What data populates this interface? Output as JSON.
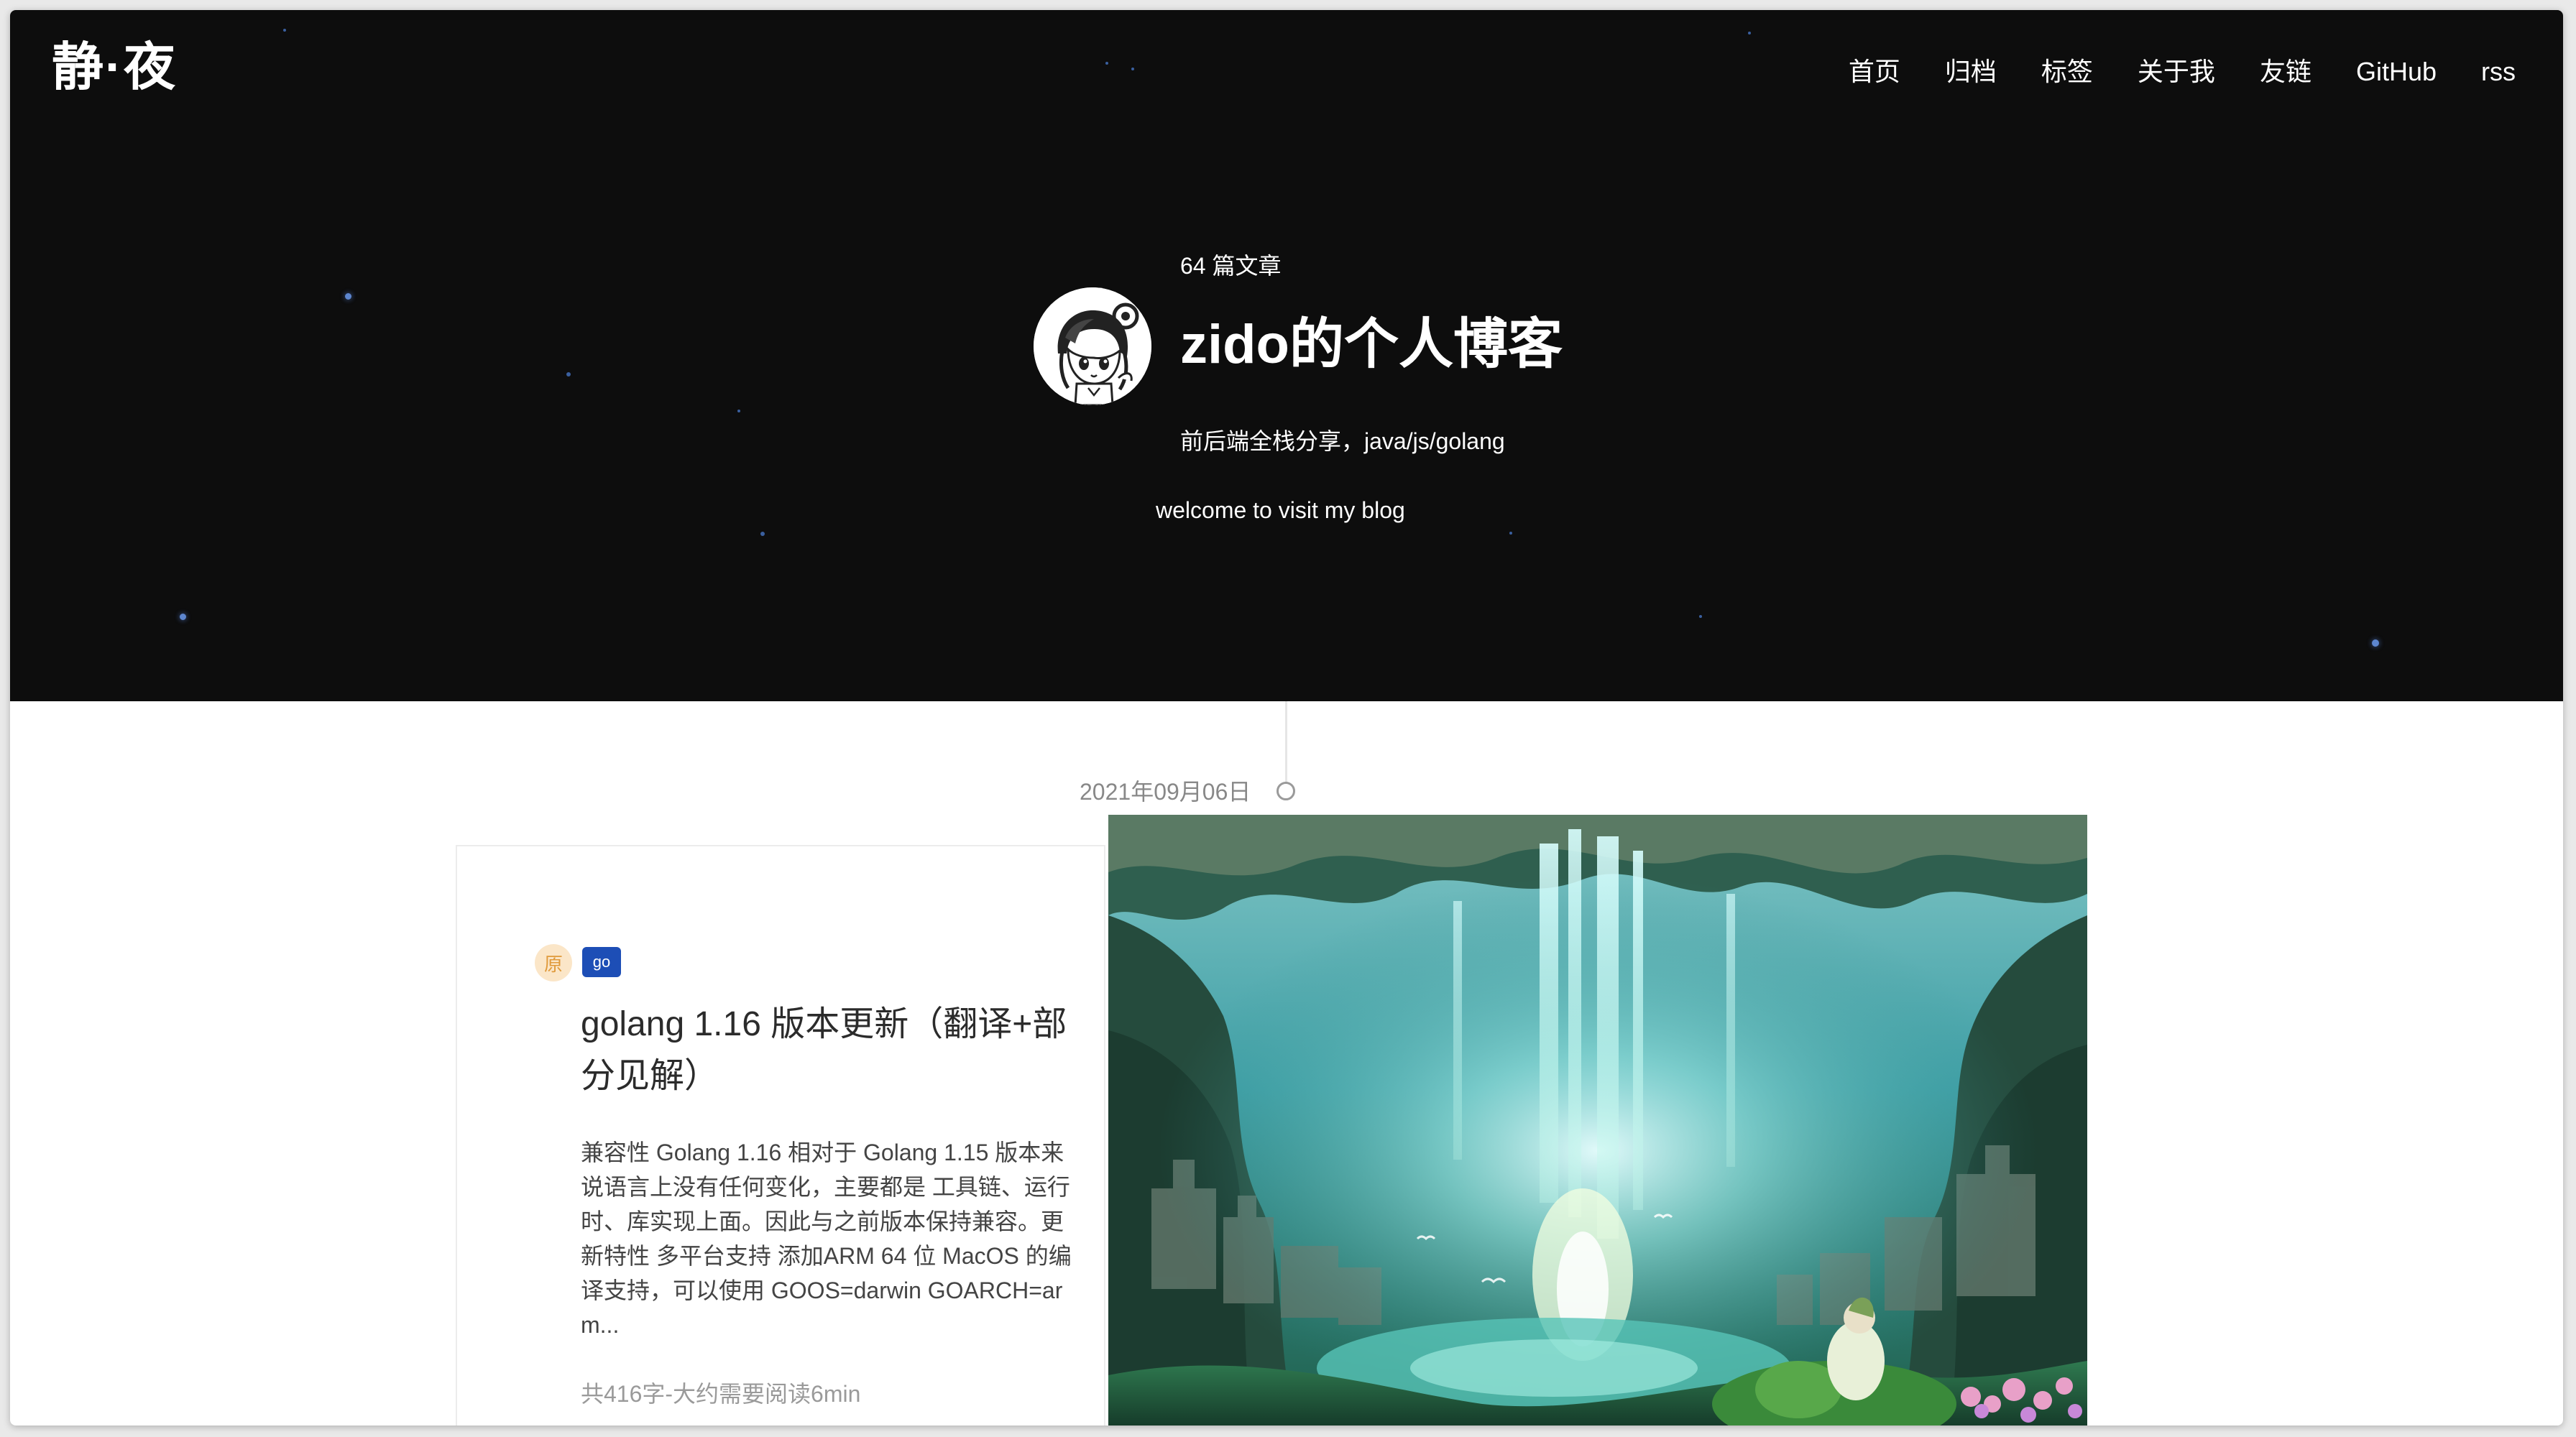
{
  "site": {
    "logo": "静·夜",
    "nav": [
      "首页",
      "归档",
      "标签",
      "关于我",
      "友链",
      "GitHub",
      "rss"
    ]
  },
  "profile": {
    "article_count": "64 篇文章",
    "title": "zido的个人博客",
    "subtitle": "前后端全栈分享，java/js/golang",
    "welcome": "welcome to visit my blog"
  },
  "post": {
    "date": "2021年09月06日",
    "original_badge": "原",
    "tag": "go",
    "title": "golang 1.16 版本更新（翻译+部分见解）",
    "excerpt": "兼容性 Golang 1.16 相对于 Golang 1.15 版本来说语言上没有任何变化，主要都是 工具链、运行时、库实现上面。因此与之前版本保持兼容。更新特性 多平台支持 添加ARM 64 位 MacOS 的编译支持，可以使用 GOOS=darwin GOARCH=arm...",
    "meta": "共416字-大约需要阅读6min"
  },
  "colors": {
    "hero_bg": "#0d0d0d",
    "tag_blue": "#1d4eb6",
    "badge_orange": "#e09a3b"
  }
}
